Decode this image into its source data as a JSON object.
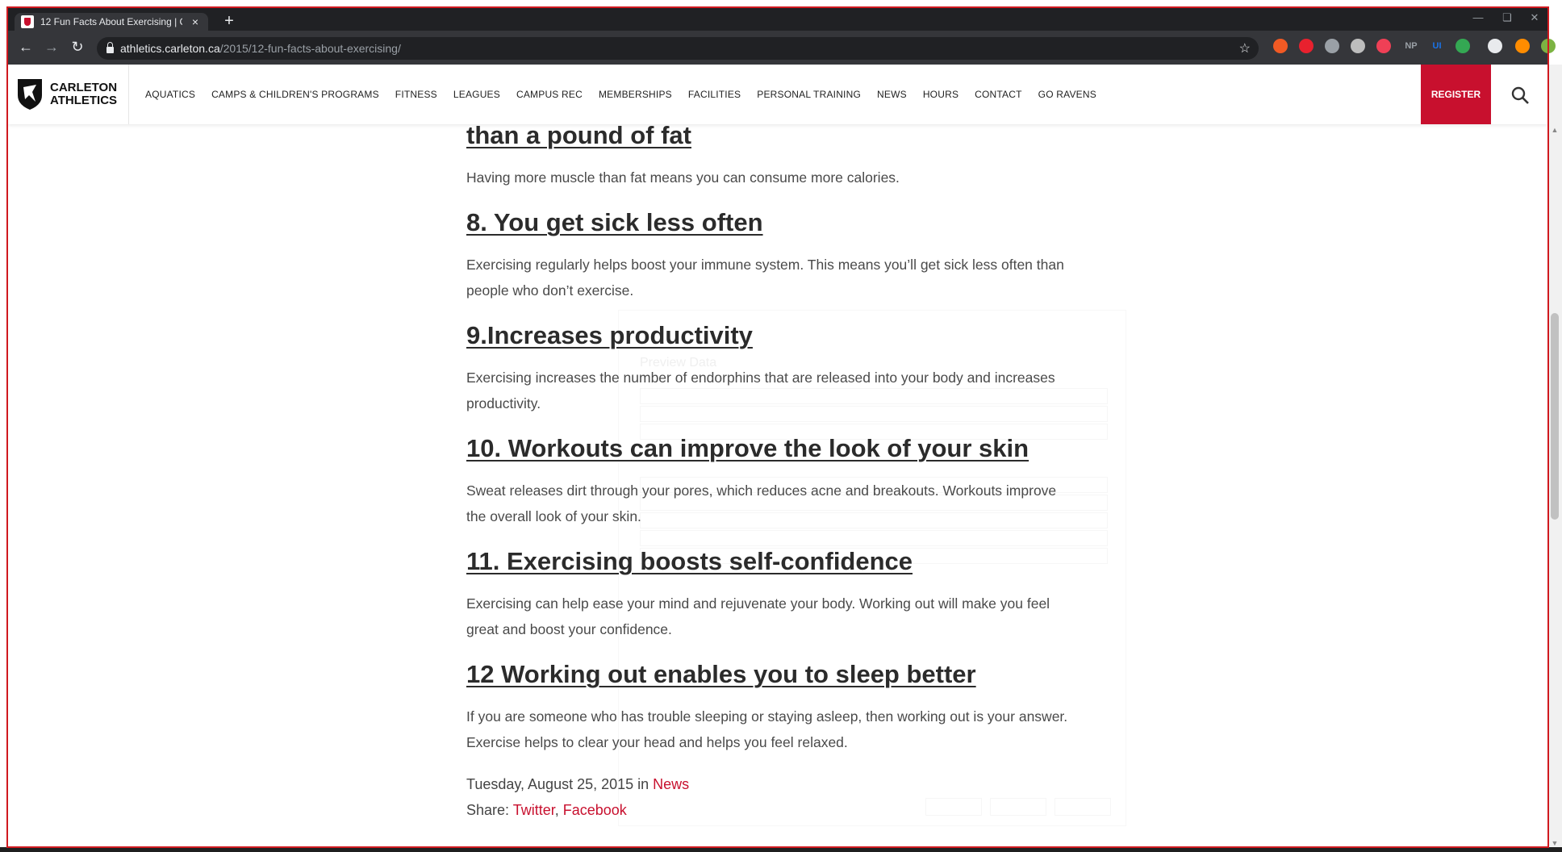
{
  "browser": {
    "tab_title": "12 Fun Facts About Exercising | C",
    "tab_close": "×",
    "new_tab": "+",
    "url_host": "athletics.carleton.ca",
    "url_path": "/2015/12-fun-facts-about-exercising/",
    "extensions": [
      {
        "name": "extension-orange-icon",
        "label": "",
        "color": "#f15a24"
      },
      {
        "name": "extension-red-icon",
        "label": "",
        "color": "#e8212e"
      },
      {
        "name": "extension-grey-icon",
        "label": "",
        "color": "#9aa0a6"
      },
      {
        "name": "extension-print-icon",
        "label": "",
        "color": "#bdbdbd"
      },
      {
        "name": "extension-pocket-icon",
        "label": "",
        "color": "#ef4056"
      },
      {
        "name": "extension-np-icon",
        "label": "NP",
        "color": "#9aa0a6"
      },
      {
        "name": "extension-ui-icon",
        "label": "UI",
        "color": "#1a73e8"
      },
      {
        "name": "extension-sync-icon",
        "label": "",
        "color": "#34a853"
      },
      {
        "name": "extension-queue-icon",
        "label": "",
        "color": "#e8eaed"
      },
      {
        "name": "extension-pumpkin-icon",
        "label": "",
        "color": "#ff8c00"
      },
      {
        "name": "profile-avatar-icon",
        "label": "",
        "color": "#7cb342"
      }
    ]
  },
  "site": {
    "logo_line1": "CARLETON",
    "logo_line2": "ATHLETICS",
    "nav": [
      "AQUATICS",
      "CAMPS & CHILDREN'S PROGRAMS",
      "FITNESS",
      "LEAGUES",
      "CAMPUS REC",
      "MEMBERSHIPS",
      "FACILITIES",
      "PERSONAL TRAINING",
      "NEWS",
      "HOURS",
      "CONTACT",
      "GO RAVENS"
    ],
    "register": "REGISTER",
    "brand_color": "#c8102e"
  },
  "article": {
    "sections": [
      {
        "heading": "than a pound of fat",
        "body": "Having more muscle than fat means you can consume more calories."
      },
      {
        "heading": "8. You get sick less often",
        "body": "Exercising regularly helps boost your immune system. This means you’ll get sick less often than people who don’t exercise."
      },
      {
        "heading": "9.Increases productivity",
        "body": "Exercising increases the number of endorphins that are released into your body and increases productivity."
      },
      {
        "heading": "10. Workouts can improve the look of your skin",
        "body": "Sweat releases dirt through your pores, which reduces acne and breakouts. Workouts improve the overall look of your skin."
      },
      {
        "heading": "11. Exercising boosts self-confidence",
        "body": "Exercising can help ease your mind and rejuvenate your body. Working out will make you feel great and boost your confidence."
      },
      {
        "heading": "12 Working out enables you to sleep better",
        "body": "If you are someone who has trouble sleeping or staying asleep, then working out is your answer. Exercise helps to clear your head and helps you feel relaxed."
      }
    ],
    "date_text": "Tuesday, August 25, 2015 in ",
    "category": "News",
    "share_label": "Share: ",
    "share_twitter": "Twitter",
    "share_sep": ", ",
    "share_facebook": "Facebook"
  },
  "ghost_dialog": {
    "title": "Preview Data"
  }
}
